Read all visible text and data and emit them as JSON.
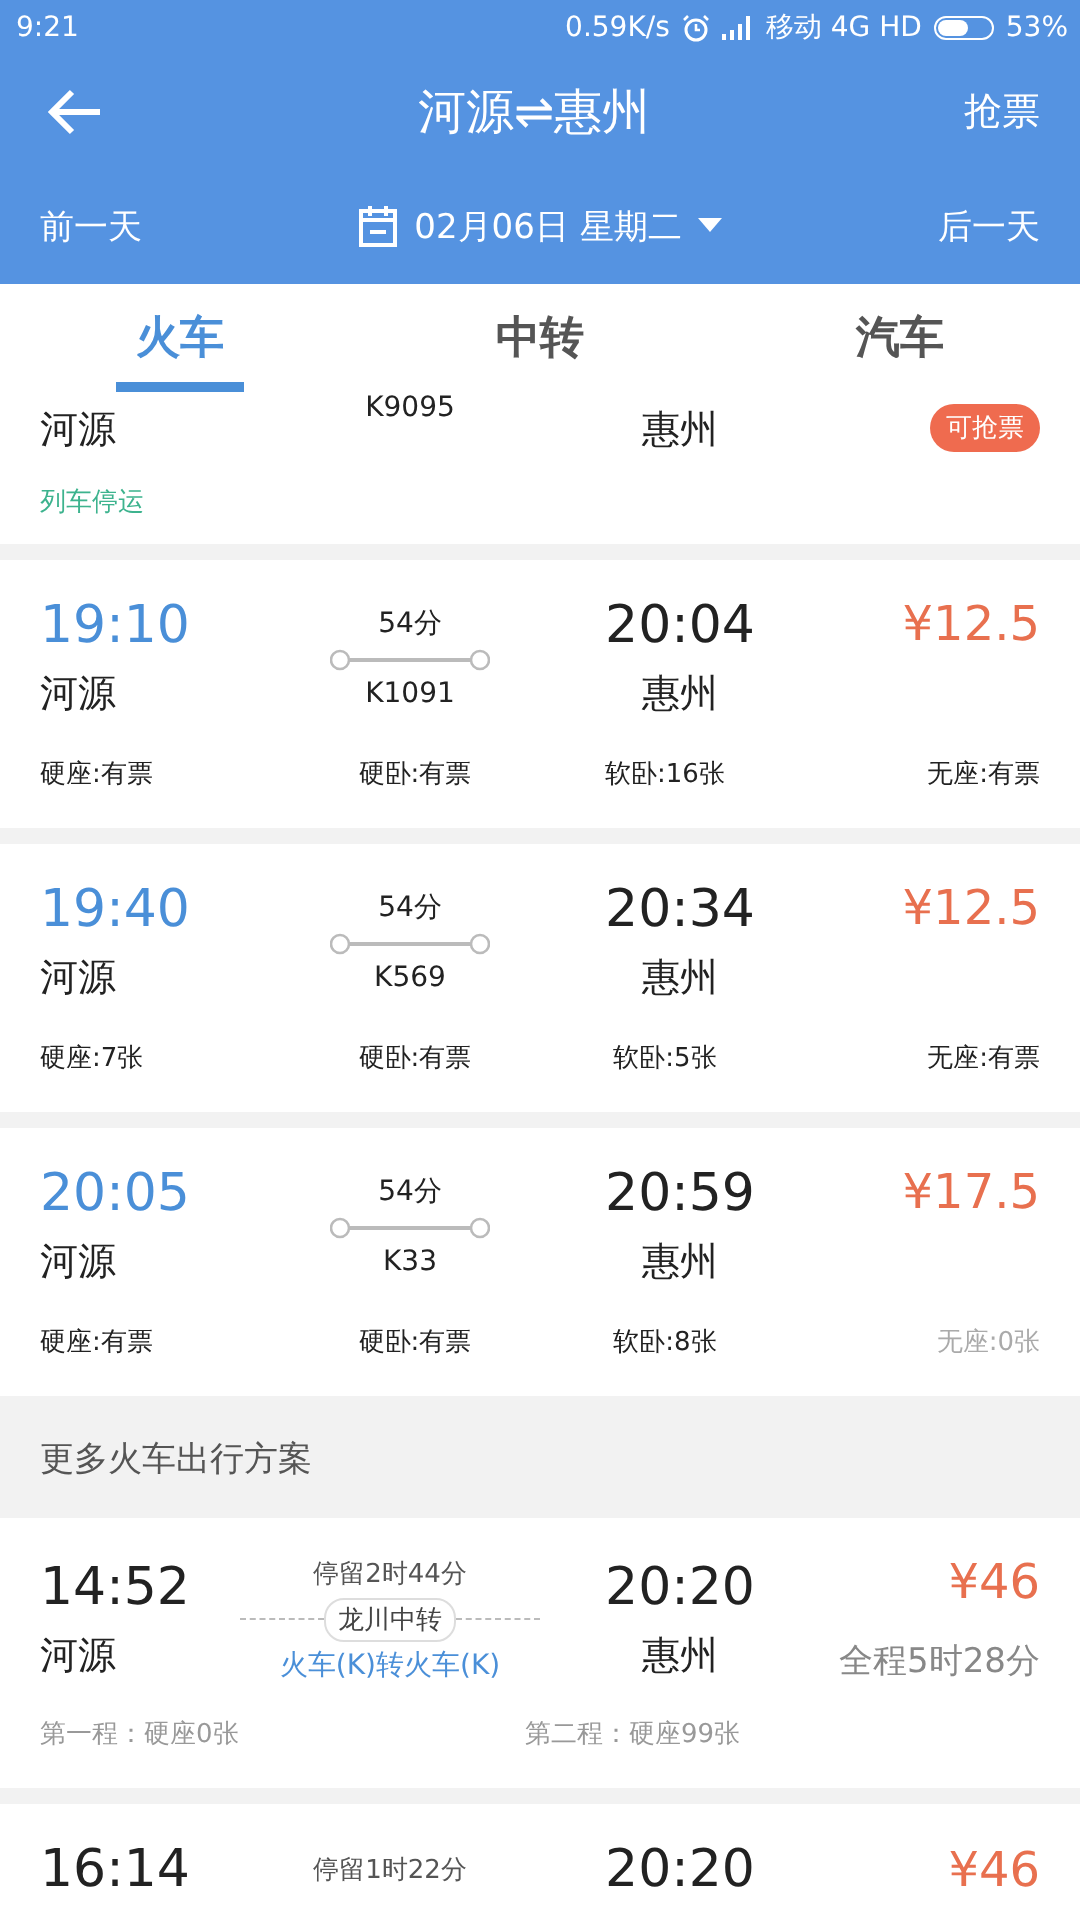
{
  "status_bar": {
    "time": "9:21",
    "speed": "0.59K/s",
    "carrier": "移动 4G HD",
    "battery": "53%"
  },
  "header": {
    "title": "河源⇌惠州",
    "action": "抢票"
  },
  "date_bar": {
    "prev": "前一天",
    "date": "02月06日 星期二",
    "next": "后一天"
  },
  "tabs": [
    {
      "label": "火车",
      "selected": true
    },
    {
      "label": "中转",
      "selected": false
    },
    {
      "label": "汽车",
      "selected": false
    }
  ],
  "partial_train": {
    "from": "河源",
    "number": "K9095",
    "to": "惠州",
    "badge": "可抢票",
    "status": "列车停运"
  },
  "trains": [
    {
      "depart": "19:10",
      "from": "河源",
      "duration": "54分",
      "number": "K1091",
      "arrive": "20:04",
      "to": "惠州",
      "price": "¥12.5",
      "seats": [
        {
          "text": "硬座:有票",
          "available": true
        },
        {
          "text": "硬卧:有票",
          "available": true
        },
        {
          "text": "软卧:16张",
          "available": true
        },
        {
          "text": "无座:有票",
          "available": true
        }
      ]
    },
    {
      "depart": "19:40",
      "from": "河源",
      "duration": "54分",
      "number": "K569",
      "arrive": "20:34",
      "to": "惠州",
      "price": "¥12.5",
      "seats": [
        {
          "text": "硬座:7张",
          "available": true
        },
        {
          "text": "硬卧:有票",
          "available": true
        },
        {
          "text": "软卧:5张",
          "available": true
        },
        {
          "text": "无座:有票",
          "available": true
        }
      ]
    },
    {
      "depart": "20:05",
      "from": "河源",
      "duration": "54分",
      "number": "K33",
      "arrive": "20:59",
      "to": "惠州",
      "price": "¥17.5",
      "seats": [
        {
          "text": "硬座:有票",
          "available": true
        },
        {
          "text": "硬卧:有票",
          "available": true
        },
        {
          "text": "软卧:8张",
          "available": true
        },
        {
          "text": "无座:0张",
          "available": false
        }
      ]
    }
  ],
  "more_section": {
    "title": "更多火车出行方案"
  },
  "transfers": [
    {
      "depart": "14:52",
      "from": "河源",
      "stay": "停留2时44分",
      "via": "龙川中转",
      "mode": "火车(K)转火车(K)",
      "arrive": "20:20",
      "to": "惠州",
      "price": "¥46",
      "total": "全程5时28分",
      "leg1": "第一程：硬座0张",
      "leg2": "第二程：硬座99张"
    },
    {
      "depart": "16:14",
      "stay": "停留1时22分",
      "arrive": "20:20",
      "price": "¥46"
    }
  ]
}
